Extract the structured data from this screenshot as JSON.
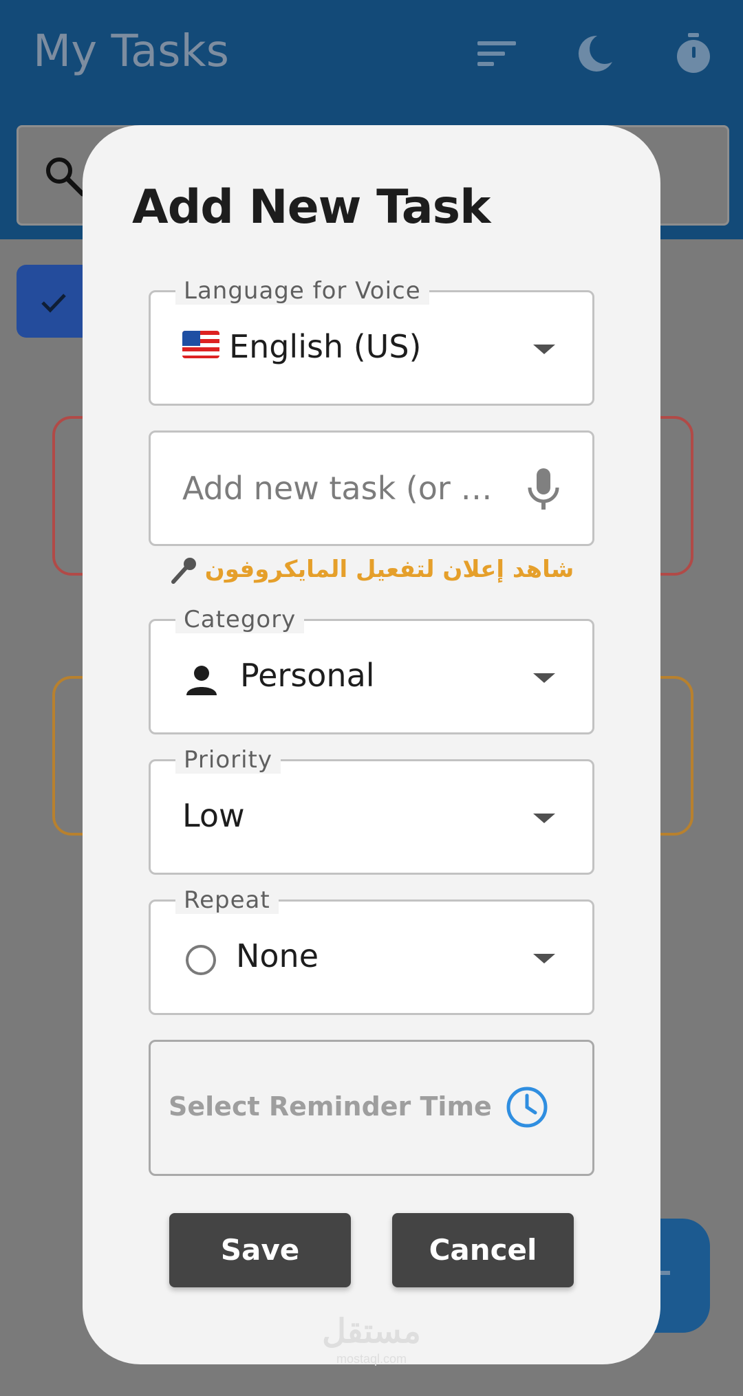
{
  "app": {
    "title": "My Tasks",
    "icons": [
      "sort-icon",
      "dark-mode-moon-icon",
      "timer-icon",
      "search-icon",
      "check-icon",
      "add-icon"
    ]
  },
  "dialog": {
    "title": "Add New Task",
    "language": {
      "label": "Language for Voice",
      "value": "English (US)",
      "flag": "US"
    },
    "task_input": {
      "placeholder": "Add new task (or …"
    },
    "ad_message": "شاهد إعلان لتفعيل المايكروفون",
    "category": {
      "label": "Category",
      "value": "Personal",
      "icon": "person-icon"
    },
    "priority": {
      "label": "Priority",
      "value": "Low"
    },
    "repeat": {
      "label": "Repeat",
      "value": "None",
      "icon": "radio-unchecked-icon"
    },
    "reminder": {
      "label": "Select Reminder Time",
      "icon": "clock-icon"
    },
    "buttons": {
      "save": "Save",
      "cancel": "Cancel"
    }
  },
  "watermark": {
    "arabic": "مستقل",
    "latin": "mostaql.com"
  },
  "colors": {
    "appbar": "#134a78",
    "dialog_bg": "#f3f3f3",
    "button_bg": "#444444",
    "ad_text": "#e59f2a",
    "clock_icon": "#2f8ee0",
    "card_red": "#b14a47",
    "card_orange": "#b8812e"
  }
}
